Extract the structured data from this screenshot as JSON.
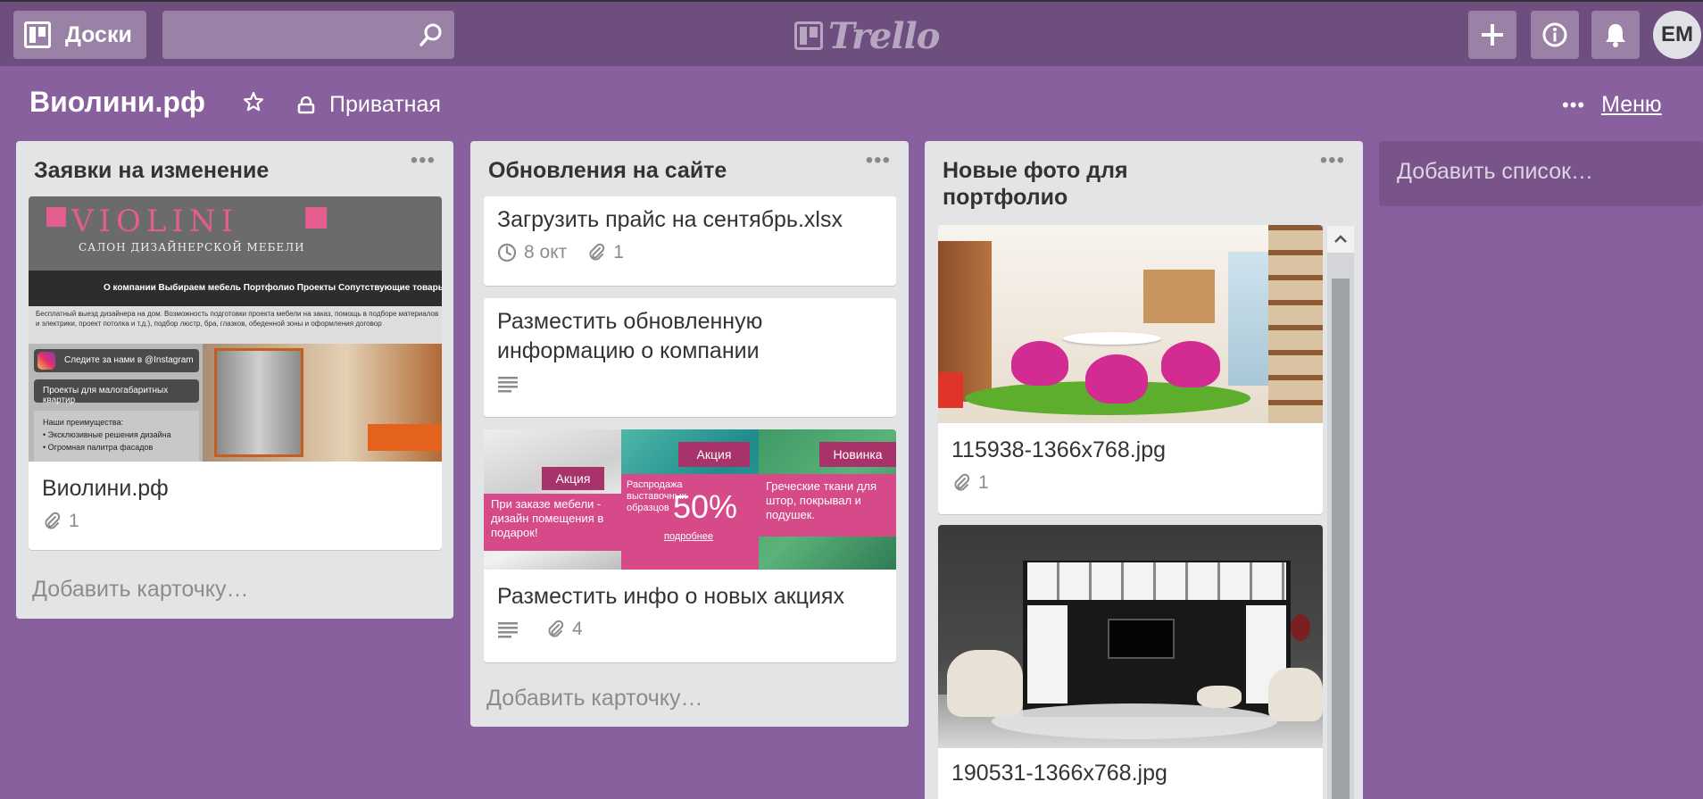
{
  "header": {
    "boards_label": "Доски",
    "logo_text": "Trello",
    "avatar_initials": "EM"
  },
  "board": {
    "title": "Виолини.рф",
    "privacy": "Приватная",
    "menu_label": "Меню"
  },
  "lists": [
    {
      "title": "Заявки на изменение",
      "cards": [
        {
          "title": "Виолини.рф",
          "attachments": "1",
          "cover": {
            "logo": "VIOLINI",
            "tagline": "САЛОН ДИЗАЙНЕРСКОЙ МЕБЕЛИ",
            "nav": "О компании   Выбираем мебель   Портфолио   Проекты   Сопутствующие товары   Мате",
            "intro": "Бесплатный выезд дизайнера на дом. Возможность подготовки проекта мебели на заказ, помощь в подборе материалов и электрики, проект потолка и т.д.), подбор люстр, бра, глазков, обеденной зоны и оформления договор",
            "instagram": "Следите за нами в @Instagram",
            "projects": "Проекты для малогабаритных квартир",
            "advantages_title": "Наши преимущества:",
            "advantages": [
              "Эксклюзивные решения дизайна",
              "Огромная палитра фасадов"
            ]
          }
        }
      ],
      "add_card": "Добавить карточку…"
    },
    {
      "title": "Обновления на сайте",
      "cards": [
        {
          "title": "Загрузить прайс на сентябрь.xlsx",
          "due": "8 окт",
          "attachments": "1"
        },
        {
          "title": "Разместить обновленную информацию о компании"
        },
        {
          "title": "Разместить инфо о новых акциях",
          "attachments": "4",
          "cover": {
            "promo1_tag": "Акция",
            "promo1_text": "При заказе мебели - дизайн помещения в подарок!",
            "promo2_tag": "Акция",
            "promo2_text": "Распродажа выставочных образцов",
            "promo2_percent": "50%",
            "promo2_link": "подробнее",
            "promo3_tag": "Новинка",
            "promo3_text": "Греческие ткани для штор, покрывал и подушек."
          }
        }
      ],
      "add_card": "Добавить карточку…"
    },
    {
      "title": "Новые фото для портфолио",
      "cards": [
        {
          "title": "115938-1366x768.jpg",
          "attachments": "1"
        },
        {
          "title": "190531-1366x768.jpg"
        }
      ]
    }
  ],
  "add_list": "Добавить список…",
  "colors": {
    "board_bg": "#89609e",
    "header_bg": "#6e4d7f",
    "list_bg": "#e2e4e6",
    "promo_pink": "#d64a8a"
  }
}
